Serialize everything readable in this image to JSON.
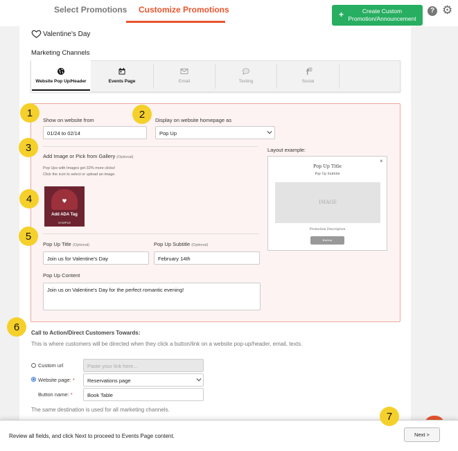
{
  "header": {
    "tabs": [
      {
        "label": "Select Promotions"
      },
      {
        "label": "Customize Promotions"
      }
    ],
    "create_button": "Create Custom Promotion/Announcement",
    "create_button_line1": "Create Custom",
    "create_button_line2": "Promotion/Announcement",
    "help_icon": "question-circle-icon",
    "settings_icon": "gear-icon"
  },
  "promotion": {
    "name": "Valentine's Day",
    "icon": "heart-icon"
  },
  "channels": {
    "title": "Marketing Channels",
    "items": [
      {
        "label": "Website Pop Up/Header",
        "icon": "globe-icon"
      },
      {
        "label": "Events Page",
        "icon": "calendar-icon"
      },
      {
        "label": "Email",
        "icon": "envelope-icon"
      },
      {
        "label": "Texting",
        "icon": "chat-icon"
      },
      {
        "label": "Social",
        "icon": "social-icon"
      }
    ]
  },
  "form": {
    "show_from_label": "Show on website from",
    "show_from_value": "01/24 to 02/14",
    "display_as_label": "Display on website homepage as",
    "display_as_value": "Pop Up",
    "image_label": "Add Image or Pick from Gallery",
    "optional": "(Optional)",
    "image_hint1": "Pop Ups with Images get 32% more clicks!",
    "image_hint2": "Click the icon to select or upload an image.",
    "ada_tag": "Add ADA Tag",
    "sample": "SAMPLE",
    "popup_title_label": "Pop Up Title",
    "popup_title_value": "Join us for Valentine's Day",
    "popup_subtitle_label": "Pop Up Subtitle",
    "popup_subtitle_value": "February 14th",
    "popup_content_label": "Pop Up Content",
    "popup_content_value": "Join us on Valentine's Day for the perfect romantic evening!",
    "layout_example_label": "Layout example:"
  },
  "layout_example": {
    "title": "Pop Up Title",
    "subtitle": "Pop Up Subtitle",
    "image": "IMAGE",
    "description": "Promotion Description",
    "button": "Button",
    "close": "×"
  },
  "cta": {
    "heading": "Call to Action/Direct Customers Towards:",
    "description": "This is where customers will be directed when they click a button/link on a website pop-up/header, email, texts.",
    "custom_url_label": "Custom url",
    "custom_url_placeholder": "Paste your link here...",
    "website_page_label": "Website page:",
    "website_page_value": "Reservations page",
    "button_name_label": "Button name:",
    "button_name_value": "Book Table",
    "required_mark": "*",
    "note": "The same destination is used for all marketing channels."
  },
  "badges": [
    "1",
    "2",
    "3",
    "4",
    "5",
    "6",
    "7"
  ],
  "footer": {
    "text": "Review all fields, and click Next to proceed to Events Page content.",
    "next": "Next >"
  }
}
